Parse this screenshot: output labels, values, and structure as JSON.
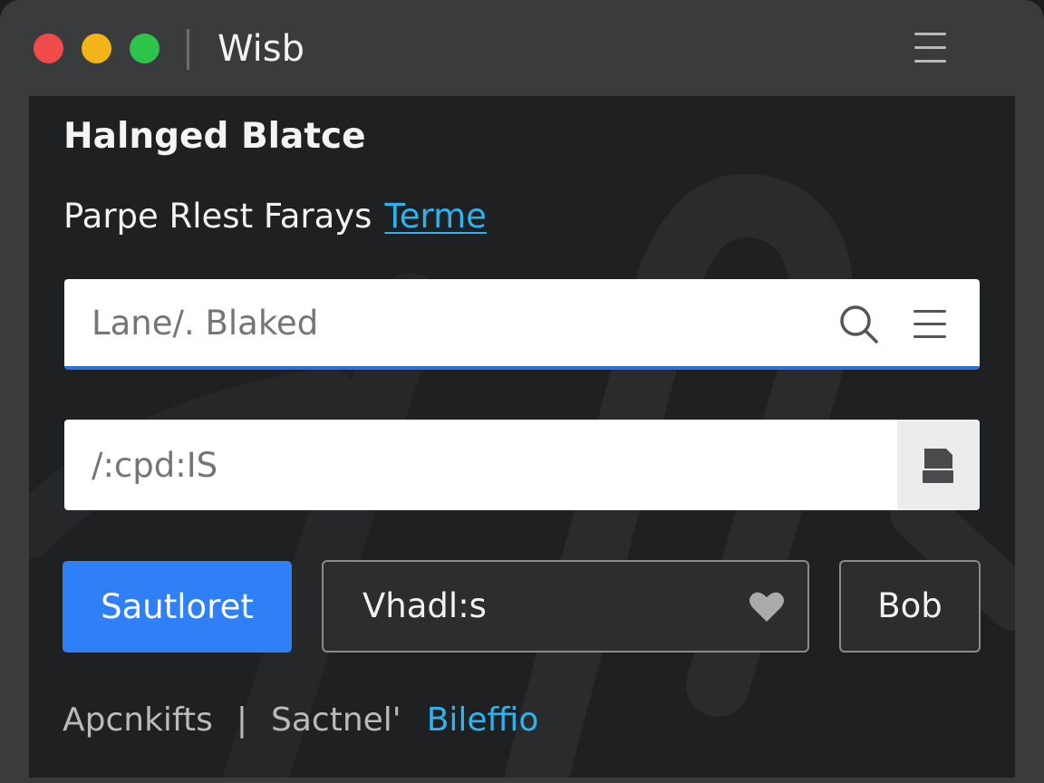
{
  "window": {
    "title": "Wisb",
    "traffic_lights": {
      "close": "#f04a4a",
      "minimize": "#f2b418",
      "maximize": "#2ec44c"
    },
    "menu_icon": "hamburger-icon"
  },
  "main": {
    "heading": "Halnged Blatce",
    "subtitle": "Parpe Rlest Farays",
    "subtitle_link": "Terme"
  },
  "search": {
    "placeholder": "Lane/. Blaked",
    "value": "",
    "search_icon": "search-icon",
    "menu_icon": "hamburger-icon"
  },
  "field": {
    "placeholder": "/:cpd:IS",
    "value": "",
    "action_icon": "save-icon"
  },
  "actions": {
    "primary_label": "Sautloret",
    "secondary_label": "Vhadl:s",
    "secondary_icon": "heart-icon",
    "tertiary_label": "Bob"
  },
  "footer": {
    "item1": "Apcnkifts",
    "separator": "|",
    "item2": "Sactnel'",
    "link": "Bileffio"
  },
  "colors": {
    "accent": "#2f7ff6",
    "link": "#2fb3ef",
    "background": "#1f2021",
    "titlebar": "#3a3b3c"
  }
}
